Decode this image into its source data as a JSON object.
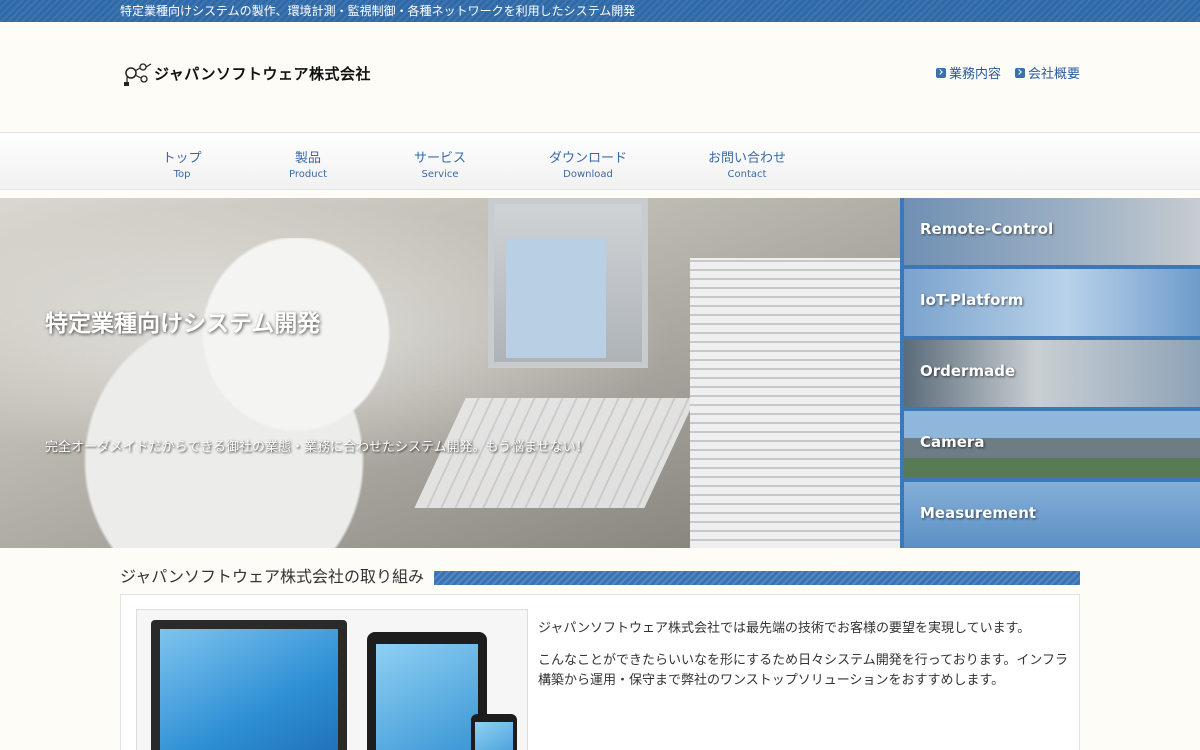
{
  "topbar": {
    "tagline": "特定業種向けシステムの製作、環境計測・監視制御・各種ネットワークを利用したシステム開発"
  },
  "header": {
    "logo_text": "ジャパンソフトウェア株式会社",
    "links": [
      {
        "label": "業務内容"
      },
      {
        "label": "会社概要"
      }
    ]
  },
  "nav": {
    "items": [
      {
        "jp": "トップ",
        "en": "Top"
      },
      {
        "jp": "製品",
        "en": "Product"
      },
      {
        "jp": "サービス",
        "en": "Service"
      },
      {
        "jp": "ダウンロード",
        "en": "Download"
      },
      {
        "jp": "お問い合わせ",
        "en": "Contact"
      }
    ]
  },
  "hero": {
    "title": "特定業種向けシステム開発",
    "subtitle": "完全オーダメイドだからできる御社の業態・業務に合わせたシステム開発。もう悩ませない！"
  },
  "side_tiles": [
    {
      "label": "Remote-Control"
    },
    {
      "label": "IoT-Platform"
    },
    {
      "label": "Ordermade"
    },
    {
      "label": "Camera"
    },
    {
      "label": "Measurement"
    }
  ],
  "section": {
    "title": "ジャパンソフトウェア株式会社の取り組み",
    "paragraphs": [
      "ジャパンソフトウェア株式会社では最先端の技術でお客様の要望を実現しています。",
      "こんなことができたらいいなを形にするため日々システム開発を行っております。インフラ構築から運用・保守まで弊社のワンストップソリューションをおすすめします。"
    ]
  },
  "colors": {
    "brand_blue": "#2f69a8",
    "nav_text": "#3a69a8",
    "tile_bg": "#3c78b8"
  }
}
